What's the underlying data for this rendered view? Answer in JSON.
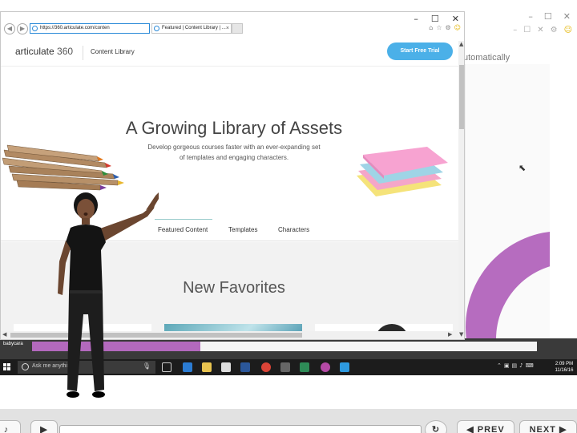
{
  "browser": {
    "url": "https://360.articulate.com/conten",
    "tab_title": "Featured | Content Library | ...",
    "tab_close": "×",
    "controls": {
      "minimize": "–",
      "maximize": "☐",
      "close": "✕"
    }
  },
  "page": {
    "logo": "articulate",
    "logo_num": "360",
    "nav_link": "Content Library",
    "cta": "Start Free Trial",
    "hero_title": "A Growing Library of Assets",
    "hero_subtitle": "Develop gorgeous courses faster with an ever-expanding set of templates and engaging characters.",
    "tabs": [
      "Featured Content",
      "Templates",
      "Characters"
    ],
    "section_title": "New Favorites"
  },
  "background_window": {
    "text": "utomatically"
  },
  "desktop": {
    "label": "babycara"
  },
  "taskbar": {
    "search_placeholder": "Ask me anything",
    "time": "2:09 PM",
    "date": "11/16/16"
  },
  "player": {
    "prev": "◀ PREV",
    "next": "NEXT ▶"
  },
  "colors": {
    "accent": "#4bb0e8",
    "purple": "#b66cbf",
    "taskbar": "#1c1c1c"
  }
}
